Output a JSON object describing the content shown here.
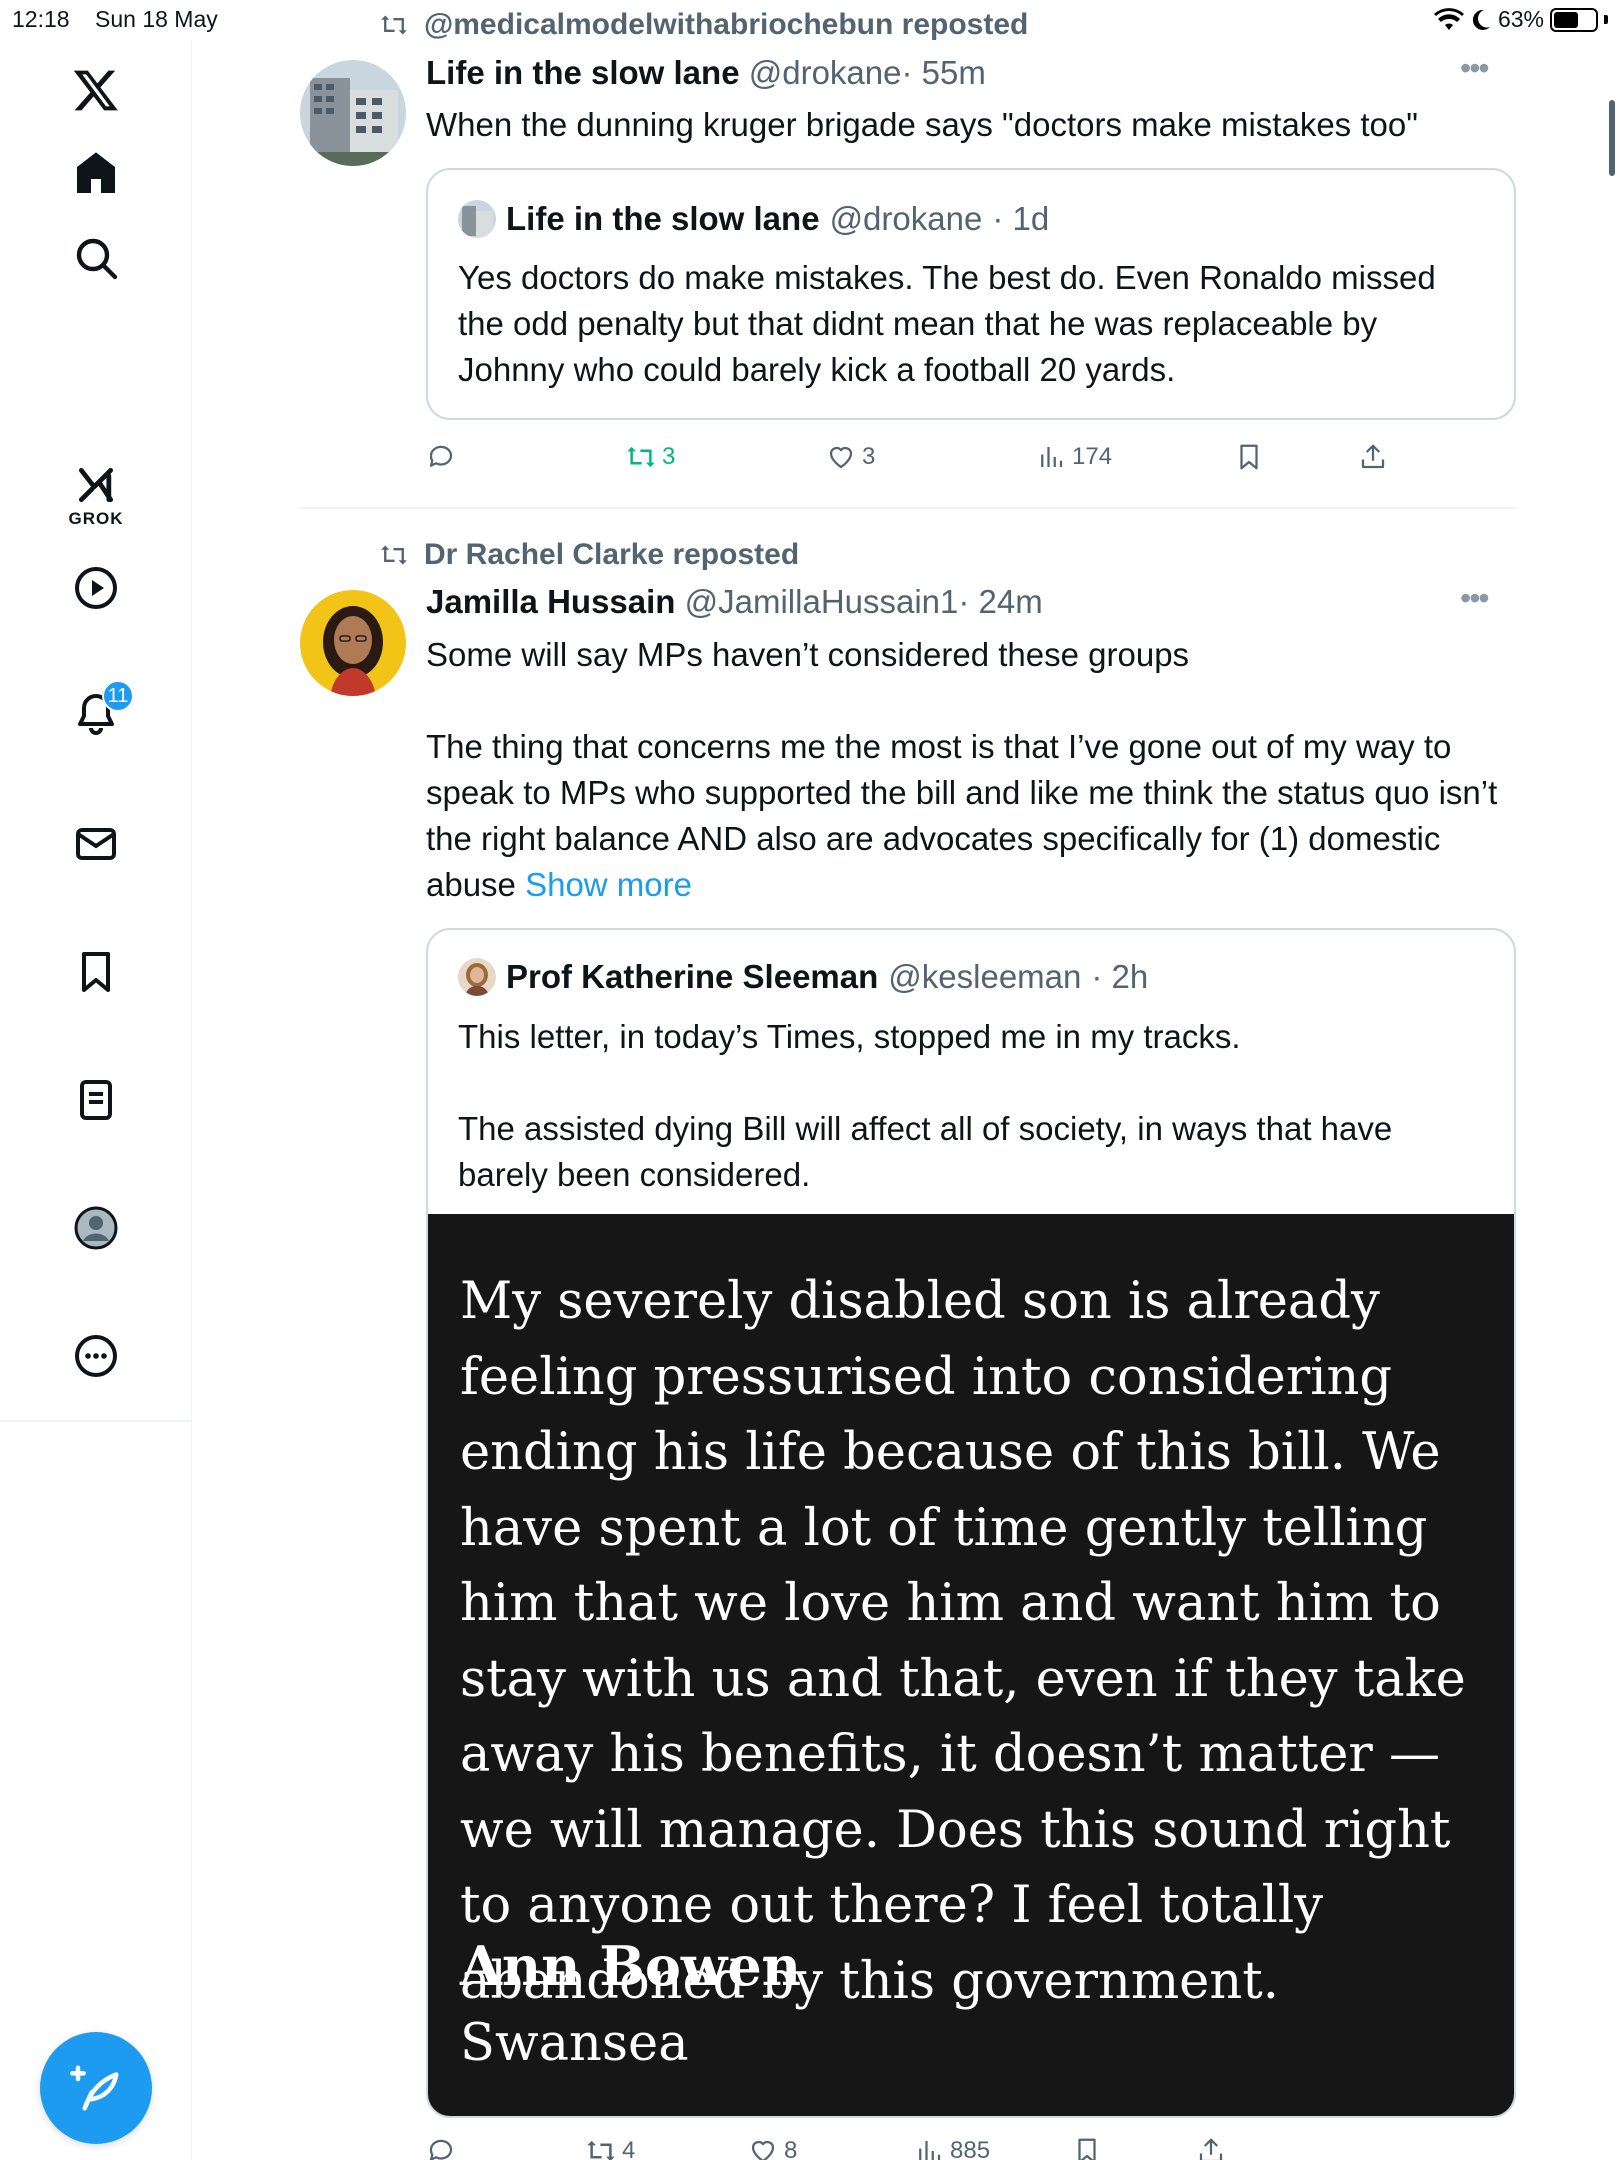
{
  "status_bar": {
    "time": "12:18",
    "date": "Sun 18 May",
    "battery": "63%",
    "battery_level": 0.63
  },
  "sidebar": {
    "items": [
      {
        "name": "x-logo-icon"
      },
      {
        "name": "home-icon"
      },
      {
        "name": "search-icon"
      },
      {
        "name": "grok-icon",
        "label": "GROK"
      },
      {
        "name": "video-icon"
      },
      {
        "name": "notifications-icon",
        "badge": "11"
      },
      {
        "name": "messages-icon"
      },
      {
        "name": "bookmarks-icon"
      },
      {
        "name": "lists-icon"
      },
      {
        "name": "profile-icon"
      },
      {
        "name": "more-icon"
      }
    ]
  },
  "feed": {
    "tweet1": {
      "repost_by": "@medicalmodelwithabriochebun reposted",
      "name": "Life in the slow lane",
      "handle": "@drokane",
      "time": "· 55m",
      "text": "When the dunning kruger brigade says \"doctors make mistakes too\"",
      "quote": {
        "name": "Life in the slow lane",
        "handle": "@drokane",
        "time": "· 1d",
        "text": "Yes doctors do make mistakes. The best do. Even Ronaldo missed the odd penalty but that didnt mean  that he was replaceable by Johnny who could barely kick a football 20 yards."
      },
      "actions": {
        "replies": "",
        "reposts": "3",
        "likes": "3",
        "views": "174"
      }
    },
    "tweet2": {
      "repost_by": "Dr Rachel Clarke reposted",
      "name": "Jamilla Hussain",
      "handle": "@JamillaHussain1",
      "time": "· 24m",
      "text_p1": "Some will say MPs haven’t considered these groups",
      "text_p2": "The thing that concerns me the most is that I’ve gone out of my way to speak to MPs who supported the bill and like me think the status quo isn’t the right balance AND also are advocates specifically for (1) domestic abuse",
      "show_more": "Show more",
      "quote": {
        "name": "Prof Katherine Sleeman",
        "handle": "@kesleeman",
        "time": "· 2h",
        "text_p1": "This letter, in today’s Times, stopped me in my tracks.",
        "text_p2": "The assisted dying Bill will affect all of society, in ways that have barely been considered.",
        "letter": {
          "body": "My severely disabled son is already feeling pressurised into considering ending his life because of this bill. We have spent a lot of time gently telling him that we love him and want him to stay with us and that, even if they take away his benefits, it doesn’t matter — we will manage. Does this sound right to anyone out there? I feel totally abandoned by this government.",
          "author": "Ann Bowen",
          "place": "Swansea"
        }
      },
      "actions": {
        "replies": "",
        "reposts": "4",
        "likes": "8",
        "views": "885"
      }
    }
  },
  "colors": {
    "accent": "#1d9bf0",
    "repost_green": "#00ba7c",
    "muted": "#536471"
  }
}
